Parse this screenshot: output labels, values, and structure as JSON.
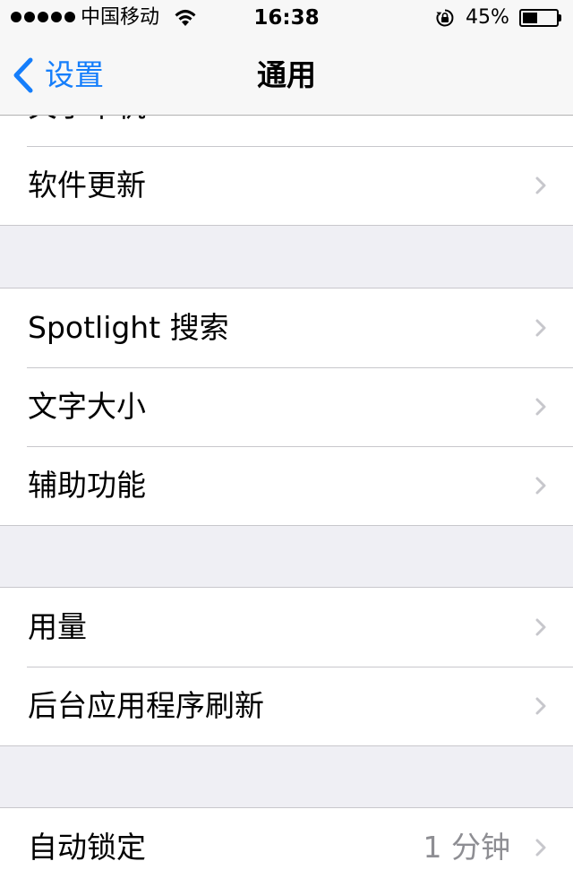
{
  "status_bar": {
    "carrier": "中国移动",
    "time": "16:38",
    "battery_percent": "45%",
    "battery_level": 0.45,
    "icons": [
      "signal-dots-icon",
      "wifi-icon",
      "rotation-lock-icon",
      "battery-icon"
    ]
  },
  "nav": {
    "back_label": "设置",
    "title": "通用"
  },
  "groups": [
    {
      "rows": [
        {
          "label": "关于本机"
        },
        {
          "label": "软件更新"
        }
      ]
    },
    {
      "rows": [
        {
          "label": "Spotlight 搜索"
        },
        {
          "label": "文字大小"
        },
        {
          "label": "辅助功能"
        }
      ]
    },
    {
      "rows": [
        {
          "label": "用量"
        },
        {
          "label": "后台应用程序刷新"
        }
      ]
    },
    {
      "rows": [
        {
          "label": "自动锁定",
          "value": "1 分钟"
        }
      ]
    }
  ],
  "colors": {
    "accent": "#157efb",
    "background": "#efeff4",
    "separator": "#c8c7cc",
    "chevron": "#c7c7cc",
    "secondary_text": "#8e8e93"
  }
}
